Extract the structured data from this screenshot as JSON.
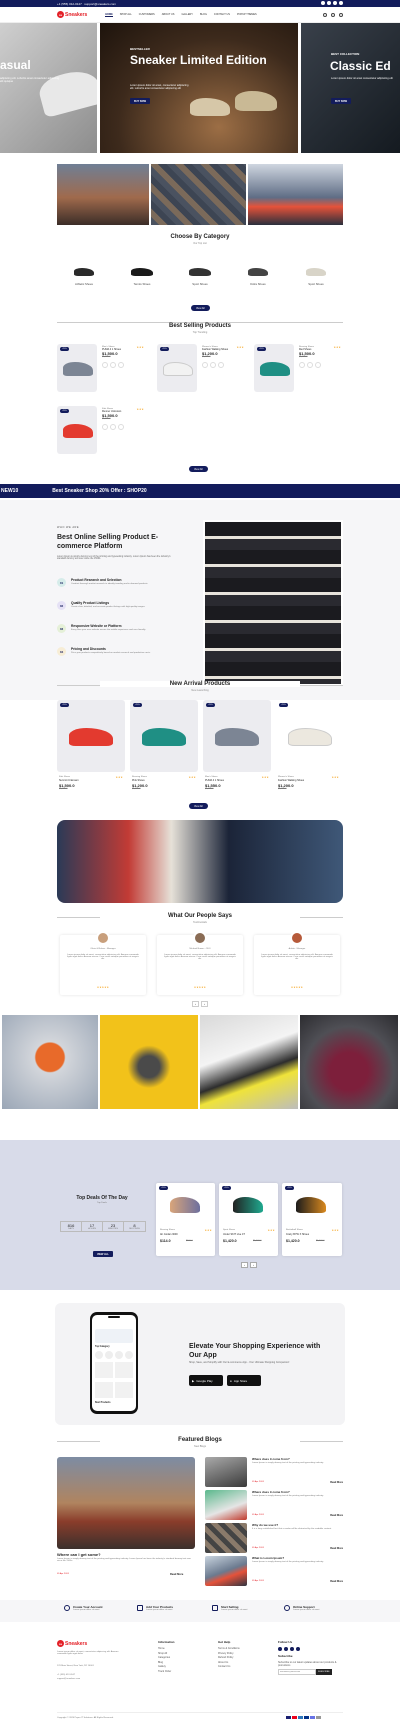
{
  "topbar": {
    "phone": "+1 (555) 012-0147",
    "email": "support@sneakers.com"
  },
  "brand": {
    "name": "Sneakers",
    "mark": "ss"
  },
  "nav": [
    "HOME",
    "SHOP ALL",
    "CUSTOMERS",
    "ABOUT US",
    "GALLERY",
    "BLOG",
    "CONTACT US",
    "POPUP THEMES"
  ],
  "hero": {
    "left": {
      "title": "asual",
      "sub": "adipiscing elit. Lobortis amet consectetur adipiscing elit quisque"
    },
    "center": {
      "eyebrow": "BESTSELLER",
      "title": "Sneaker Limited Edition",
      "sub": "Lorem ipsum dolor sit amet, consectetur adipiscing elit. Lobortis amet consectetur adipiscing elit",
      "button": "BUY NOW"
    },
    "right": {
      "eyebrow": "BEST COLLECTION",
      "title": "Classic Ed",
      "sub": "Lorem ipsum dolor sit amet consectetur adipiscing elit",
      "button": "BUY NOW"
    }
  },
  "category": {
    "title": "Choose By Category",
    "sub": "Our Top List",
    "items": [
      "Athletic Shoes",
      "Tennis Shoes",
      "Sport Shoes",
      "Kicks Shoes",
      "Sport Shoes"
    ],
    "button": "View All"
  },
  "bestselling": {
    "title": "Best Selling Products",
    "sub": "Top Trending",
    "button": "View All",
    "products": [
      {
        "tag": "-25%",
        "cat": "Men's Shoes",
        "name": "PUMA 4 1 Shoes",
        "price": "$1,500.0",
        "old": "$1,600.0"
      },
      {
        "tag": "-25%",
        "cat": "Women's Shoes",
        "name": "Fashion Walking Shoes",
        "price": "$1,200.0",
        "old": "$1,600.0"
      },
      {
        "tag": "-25%",
        "cat": "Running Shoes",
        "name": "Red Shoes",
        "price": "$1,500.0",
        "old": "$1,600.0"
      },
      {
        "tag": "-25%",
        "cat": "Kids Shoes",
        "name": "Runner Unknown",
        "price": "$1,500.0",
        "old": "$1,600.0"
      }
    ]
  },
  "ticker": {
    "left": "NEW10",
    "main": "Best Sneaker Shop 20% Offer : SHOP20"
  },
  "about": {
    "eyebrow": "WHO WE ARE",
    "title": "Best Online Selling Product E-commerce Platform",
    "desc": "Lorem Ipsum is simply dummy text of the printing and typesetting industry. Lorem Ipsum has been the industry's standard dummy text ever since the 1500s.",
    "features": [
      {
        "num": "01",
        "title": "Product Research and Selection",
        "desc": "Conduct thorough market research to identify trending and in-demand products."
      },
      {
        "num": "02",
        "title": "Quality Product Listings",
        "desc": "Create clear, detailed, and accurate product listings with high-quality images."
      },
      {
        "num": "03",
        "title": "Responsive Website or Platform",
        "desc": "Every fiber your user website ensure the mobile experience and user friendly."
      },
      {
        "num": "04",
        "title": "Pricing and Discounts",
        "desc": "Price your products competitively based on market research and production costs."
      }
    ]
  },
  "arrival": {
    "title": "New Arrival Products",
    "sub": "New Launching",
    "button": "View All",
    "products": [
      {
        "tag": "-25%",
        "cat": "Kids Shoes",
        "name": "Summit Unknown",
        "price": "$1,500.0",
        "old": "$1,600.0"
      },
      {
        "tag": "-25%",
        "cat": "Running Shoes",
        "name": "Pink Shoes",
        "price": "$1,200.0",
        "old": "$1,600.0"
      },
      {
        "tag": "-25%",
        "cat": "Men's Shoes",
        "name": "PUMA 4 1 Shoes",
        "price": "$1,550.0",
        "old": "$1,600.0"
      },
      {
        "tag": "-25%",
        "cat": "Women's Shoes",
        "name": "Fashion Walking Shoes",
        "price": "$1,200.0",
        "old": "$1,600.0"
      }
    ]
  },
  "testimonials": {
    "title": "What Our People Says",
    "sub": "Testimonials",
    "items": [
      {
        "name": "Olivia & Rohan - Manager",
        "text": "Lorem ipsum dolor sit amet, consectetur adipiscing elit. Aenean commodo ligula eget dolor. Aenean massa. Cum sociis natoque penatibus et magnis dis."
      },
      {
        "name": "Michael Brown - CEO",
        "text": "Lorem ipsum dolor sit amet, consectetur adipiscing elit. Aenean commodo ligula eget dolor. Aenean massa. Cum sociis natoque penatibus et magnis dis."
      },
      {
        "name": "Ankita - Manager",
        "text": "Lorem ipsum dolor sit amet, consectetur adipiscing elit. Aenean commodo ligula eget dolor. Aenean massa. Cum sociis natoque penatibus et magnis dis."
      }
    ]
  },
  "deals": {
    "title": "Top Deals Of The Day",
    "sub": "Top Deals",
    "timer": [
      {
        "v": "816",
        "l": "DAYS"
      },
      {
        "v": "17",
        "l": "HOURS"
      },
      {
        "v": "23",
        "l": "MINUTES"
      },
      {
        "v": "8",
        "l": "SECONDS"
      }
    ],
    "button": "VIEW ALL",
    "products": [
      {
        "tag": "-25%",
        "cat": "Running Shoes",
        "name": "Air Jordan 3000",
        "price": "$114.0",
        "old": "$160.0"
      },
      {
        "tag": "-25%",
        "cat": "Sport Shoes",
        "name": "Under SKIT Live 4T",
        "price": "$1,420.0",
        "old": "$1,600.0"
      },
      {
        "tag": "-25%",
        "cat": "Basketball Shoes",
        "name": "Crazy BYW X Shoes",
        "price": "$1,420.0",
        "old": "$1,600.0"
      }
    ]
  },
  "app": {
    "title": "Elevate Your Shopping Experience with Our App",
    "sub": "Shop, Save, and Simplify with Our E-commerce App - Your Ultimate Shopping Companion!",
    "google": "Google Play",
    "apple": "App Store",
    "phone_title": "Top Category",
    "phone_sub": "Best Products"
  },
  "blogs": {
    "title": "Featured Blogs",
    "sub": "New Blogs",
    "main": {
      "title": "Where can I get some?",
      "desc": "Lorem Ipsum is simply dummy text of the printing and typesetting industry. Lorem Ipsum has been the industry's standard dummy text ever since the 1500s.",
      "date": "05 Apr 2024",
      "more": "Read More"
    },
    "side": [
      {
        "title": "Where does it come from?",
        "desc": "Lorem Ipsum is simply dummy text of the printing and typesetting industry.",
        "date": "05 Apr 2024",
        "more": "Read More"
      },
      {
        "title": "Where does it come from?",
        "desc": "Lorem Ipsum is simply dummy text of the printing and typesetting industry.",
        "date": "05 Apr 2024",
        "more": "Read More"
      },
      {
        "title": "Why do we use it?",
        "desc": "It is a long established fact that a reader will be distracted by the readable content.",
        "date": "05 Apr 2024",
        "more": "Read More"
      },
      {
        "title": "What is Lorem Ipsum?",
        "desc": "Lorem Ipsum is simply dummy text of the printing and typesetting industry.",
        "date": "05 Apr 2024",
        "more": "Read More"
      }
    ]
  },
  "steps": [
    {
      "title": "Create Your Account",
      "sub": "Lorem ipsum dolor sit amet"
    },
    {
      "title": "Add Your Products",
      "sub": "Lorem ipsum dolor sit amet"
    },
    {
      "title": "Start Selling",
      "sub": "Lorem ipsum dolor sit amet"
    },
    {
      "title": "Online Support",
      "sub": "Lorem ipsum dolor sit amet"
    }
  ],
  "footer": {
    "about": "Lorem ipsum dolor sit amet, consectetur adipiscing elit. Aenean commodo ligula eget dolor.",
    "address": "123 Main Street, New York, NY 10001",
    "phone": "+1 (555) 012-0147",
    "email": "support@sneakers.com",
    "info_title": "Information",
    "info": [
      "Home",
      "Shop All",
      "Categories",
      "Blog",
      "Gallery",
      "Track Order"
    ],
    "help_title": "Get Help",
    "help": [
      "Terms & Conditions",
      "Privacy Policy",
      "Refund Policy",
      "About Us",
      "Contact Us"
    ],
    "follow_title": "Follow Us",
    "sub_title": "Subscribe",
    "sub_desc": "Subscribe to our latest updates about our products & promotions",
    "sub_placeholder": "username@email.com",
    "sub_button": "SUBSCRIBE",
    "copyright": "Copyright © 2024 Pepro IT Solutions. All Rights Reserved."
  }
}
